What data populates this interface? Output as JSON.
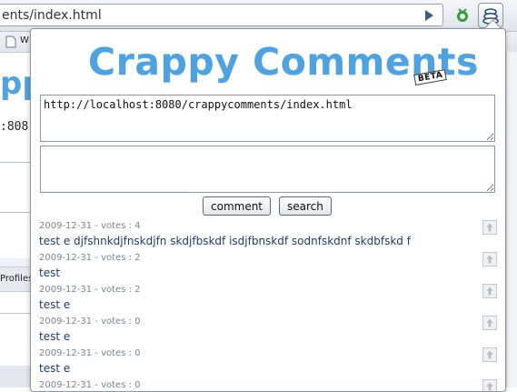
{
  "browser": {
    "url": "ents/index.html",
    "bookmark_label": "W"
  },
  "background_page": {
    "logo_fragment": "pp",
    "url_fragment": ":808",
    "tab_label": "Profiles"
  },
  "popup": {
    "title": "Crappy Comments",
    "beta_badge": "BETA",
    "url_field_value": "http://localhost:8080/crappycomments/index.html",
    "comment_field_value": "",
    "comment_button": "comment",
    "search_button": "search",
    "comments": [
      {
        "date": "2009-12-31",
        "votes_label": "votes : 4",
        "text": "test e djfshnkdjfnskdjfn skdjfbskdf isdjfbnskdf sodnfskdnf skdbfskd f"
      },
      {
        "date": "2009-12-31",
        "votes_label": "votes : 2",
        "text": "test"
      },
      {
        "date": "2009-12-31",
        "votes_label": "votes : 2",
        "text": "test e"
      },
      {
        "date": "2009-12-31",
        "votes_label": "votes : 0",
        "text": "test e"
      },
      {
        "date": "2009-12-31",
        "votes_label": "votes : 0",
        "text": "test e"
      },
      {
        "date": "2009-12-31",
        "votes_label": "votes : 0",
        "text": ""
      }
    ]
  },
  "colors": {
    "title_blue": "#4da2df",
    "comment_text": "#1d3c6e",
    "meta_gray": "#7a8591"
  }
}
